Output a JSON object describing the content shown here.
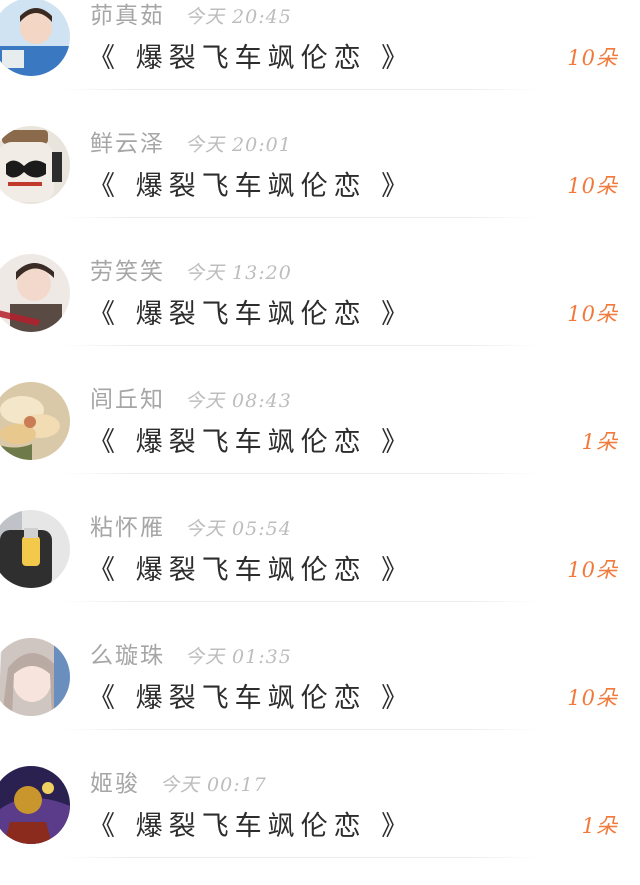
{
  "records": [
    {
      "name": "茆真茹",
      "time": "今天 20:45",
      "title": "《 爆裂飞车飒伦恋 》",
      "gift": "10朵",
      "avatar": "avatar-child-photo"
    },
    {
      "name": "鲜云泽",
      "time": "今天 20:01",
      "title": "《 爆裂飞车飒伦恋 》",
      "gift": "10朵",
      "avatar": "avatar-jar-mustache"
    },
    {
      "name": "劳笑笑",
      "time": "今天 13:20",
      "title": "《 爆裂飞车飒伦恋 》",
      "gift": "10朵",
      "avatar": "avatar-young-man"
    },
    {
      "name": "闾丘知",
      "time": "今天 08:43",
      "title": "《 爆裂飞车飒伦恋 》",
      "gift": "1朵",
      "avatar": "avatar-flower"
    },
    {
      "name": "粘怀雁",
      "time": "今天 05:54",
      "title": "《 爆裂飞车飒伦恋 》",
      "gift": "10朵",
      "avatar": "avatar-girl-drink"
    },
    {
      "name": "么璇珠",
      "time": "今天 01:35",
      "title": "《 爆裂飞车飒伦恋 》",
      "gift": "10朵",
      "avatar": "avatar-girl-portrait"
    },
    {
      "name": "姬骏",
      "time": "今天 00:17",
      "title": "《 爆裂飞车飒伦恋 》",
      "gift": "1朵",
      "avatar": "avatar-game-hero"
    }
  ],
  "colors": {
    "name": "#a6a6a6",
    "time": "#bdbdbd",
    "title": "#2d2d2d",
    "gift": "#f07a3c"
  }
}
